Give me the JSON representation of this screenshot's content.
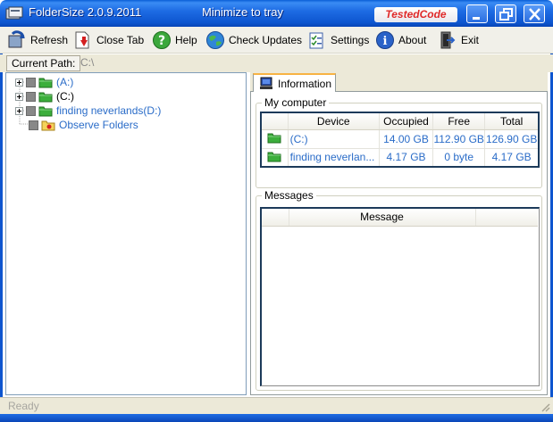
{
  "window": {
    "title": "FolderSize 2.0.9.2011",
    "tray_label": "Minimize to tray",
    "brand": "TestedCode",
    "buttons": {
      "minimize": "minimize",
      "maximize": "maximize",
      "close": "close"
    }
  },
  "toolbar": {
    "items": [
      {
        "label": "Refresh",
        "icon": "refresh-icon"
      },
      {
        "label": "Close Tab",
        "icon": "close-tab-icon"
      },
      {
        "label": "Help",
        "icon": "help-icon"
      },
      {
        "label": "Check Updates",
        "icon": "globe-icon"
      },
      {
        "label": "Settings",
        "icon": "settings-icon"
      },
      {
        "label": "About",
        "icon": "info-icon"
      },
      {
        "label": "Exit",
        "icon": "exit-icon"
      }
    ]
  },
  "path_bar": {
    "label": "Current Path:",
    "value": "C:\\"
  },
  "tree": {
    "nodes": [
      {
        "label": "(A:)",
        "icon": "folder-icon"
      },
      {
        "label": "(C:)",
        "icon": "folder-icon"
      },
      {
        "label": "finding neverlands(D:)",
        "icon": "folder-icon"
      },
      {
        "label": "Observe Folders",
        "icon": "observe-folder-icon"
      }
    ]
  },
  "tab": {
    "label": "Information",
    "icon": "computer-icon"
  },
  "my_computer": {
    "title": "My computer",
    "columns": [
      "Device",
      "Occupied",
      "Free",
      "Total"
    ],
    "rows": [
      {
        "device": "(C:)",
        "occupied": "14.00 GB",
        "free": "112.90 GB",
        "total": "126.90 GB"
      },
      {
        "device": "finding neverlan...",
        "occupied": "4.17 GB",
        "free": "0 byte",
        "total": "4.17 GB"
      }
    ]
  },
  "messages": {
    "title": "Messages",
    "columns": [
      "Message"
    ]
  },
  "status": {
    "text": "Ready"
  },
  "colors": {
    "title_bar": "#1e6ce4",
    "accent_blue": "#2a6cc8",
    "toolbar_bg": "#f1f0e9",
    "frame_bg": "#ece9d8"
  }
}
